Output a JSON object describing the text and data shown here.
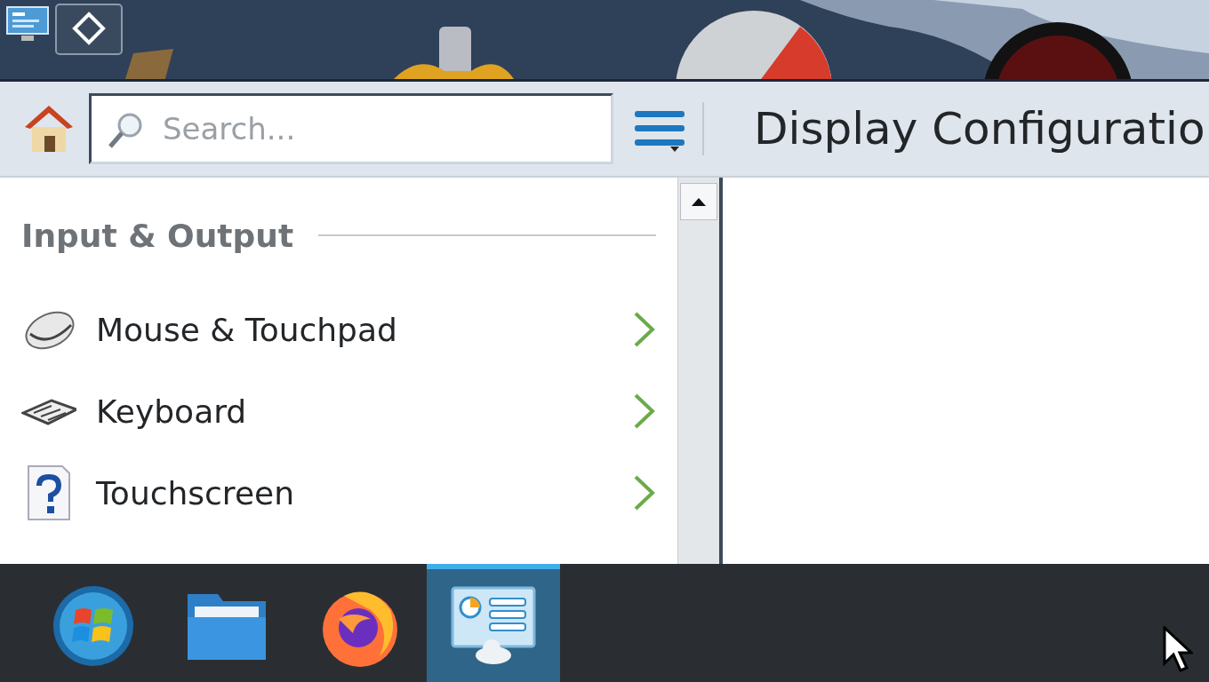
{
  "toolbar": {
    "search": {
      "placeholder": "Search..."
    },
    "title": "Display Configuratio"
  },
  "sidebar": {
    "section": "Input & Output",
    "items": [
      {
        "label": "Mouse & Touchpad",
        "kind": "mouse"
      },
      {
        "label": "Keyboard",
        "kind": "keyboard"
      },
      {
        "label": "Touchscreen",
        "kind": "help"
      }
    ]
  },
  "taskbar": {
    "tasks": [
      {
        "kind": "start",
        "selected": false
      },
      {
        "kind": "folder",
        "selected": false
      },
      {
        "kind": "browser",
        "selected": false
      },
      {
        "kind": "settings",
        "selected": true
      }
    ]
  }
}
